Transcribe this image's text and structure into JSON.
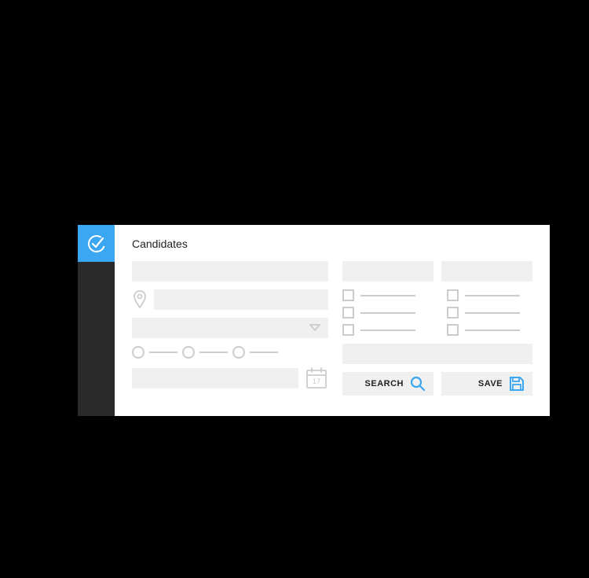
{
  "page": {
    "title": "Candidates"
  },
  "actions": {
    "search_label": "SEARCH",
    "save_label": "SAVE"
  },
  "calendar": {
    "day": "17"
  },
  "colors": {
    "accent": "#3ba7f2",
    "placeholder": "#f0f0f0",
    "stroke": "#cccccc"
  }
}
